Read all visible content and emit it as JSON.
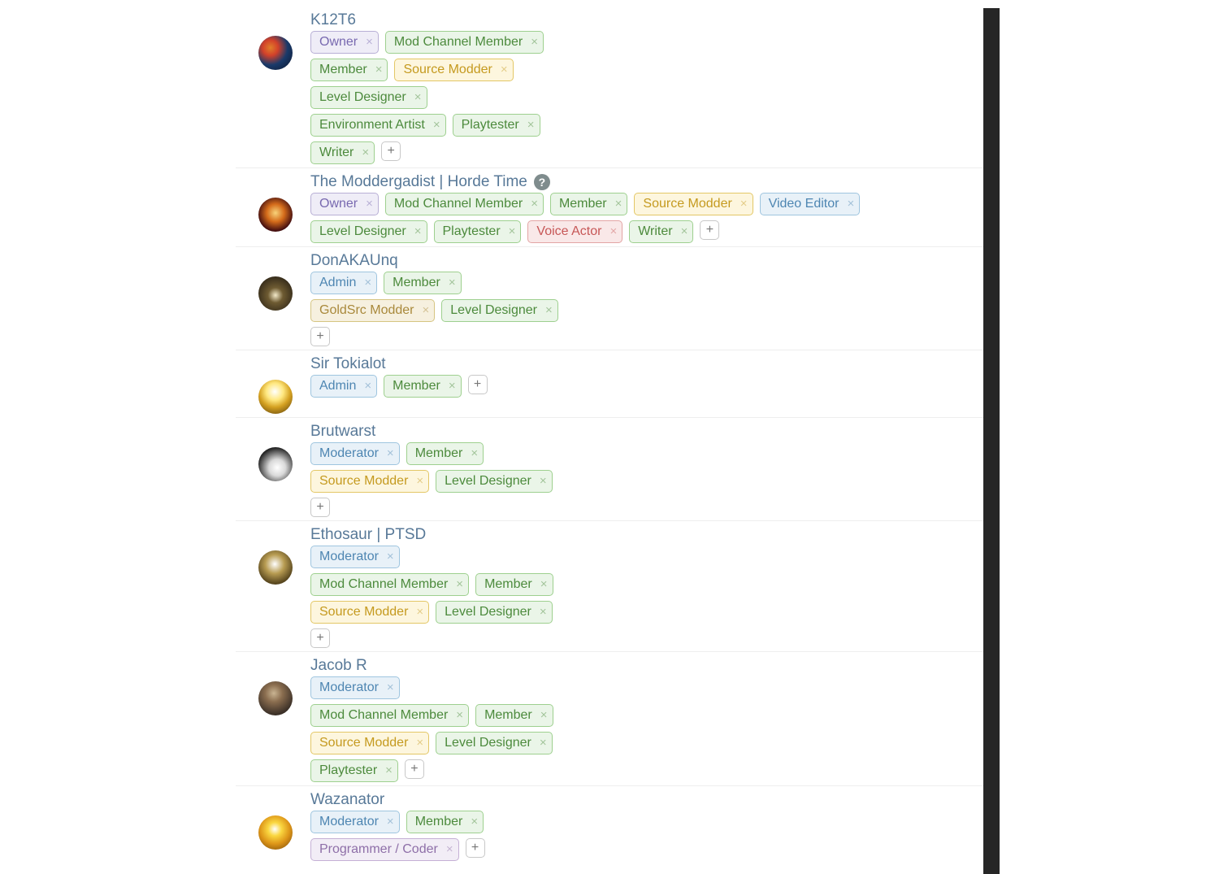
{
  "addLabel": "+",
  "removeLabel": "×",
  "members": [
    {
      "name": "K12T6",
      "avatarClass": "av-a",
      "tagRowMax": "315px",
      "hasQuestion": false,
      "tags": [
        {
          "label": "Owner",
          "color": "c-lav"
        },
        {
          "label": "Mod Channel Member",
          "color": "c-green"
        },
        {
          "label": "Member",
          "color": "c-green"
        },
        {
          "label": "Source Modder",
          "color": "c-yellow"
        },
        {
          "label": "Level Designer",
          "color": "c-green"
        },
        {
          "label": "Environment Artist",
          "color": "c-green"
        },
        {
          "label": "Playtester",
          "color": "c-green"
        },
        {
          "label": "Writer",
          "color": "c-green"
        }
      ]
    },
    {
      "name": "The Moddergadist | Horde Time",
      "avatarClass": "av-b",
      "tagRowMax": "720px",
      "hasQuestion": true,
      "tags": [
        {
          "label": "Owner",
          "color": "c-lav"
        },
        {
          "label": "Mod Channel Member",
          "color": "c-green"
        },
        {
          "label": "Member",
          "color": "c-green"
        },
        {
          "label": "Source Modder",
          "color": "c-yellow"
        },
        {
          "label": "Video Editor",
          "color": "c-blue"
        },
        {
          "label": "Level Designer",
          "color": "c-green"
        },
        {
          "label": "Playtester",
          "color": "c-green"
        },
        {
          "label": "Voice Actor",
          "color": "c-red"
        },
        {
          "label": "Writer",
          "color": "c-green"
        }
      ]
    },
    {
      "name": "DonAKAUnq",
      "avatarClass": "av-c",
      "tagRowMax": "305px",
      "hasQuestion": false,
      "tags": [
        {
          "label": "Admin",
          "color": "c-blue"
        },
        {
          "label": "Member",
          "color": "c-green"
        },
        {
          "label": "GoldSrc Modder",
          "color": "c-tan"
        },
        {
          "label": "Level Designer",
          "color": "c-green"
        }
      ]
    },
    {
      "name": "Sir Tokialot",
      "avatarClass": "av-d",
      "tagRowMax": "620px",
      "hasQuestion": false,
      "tags": [
        {
          "label": "Admin",
          "color": "c-blue"
        },
        {
          "label": "Member",
          "color": "c-green"
        }
      ]
    },
    {
      "name": "Brutwarst",
      "avatarClass": "av-e",
      "tagRowMax": "305px",
      "hasQuestion": false,
      "tags": [
        {
          "label": "Moderator",
          "color": "c-blue"
        },
        {
          "label": "Member",
          "color": "c-green"
        },
        {
          "label": "Source Modder",
          "color": "c-yellow"
        },
        {
          "label": "Level Designer",
          "color": "c-green"
        }
      ]
    },
    {
      "name": "Ethosaur | PTSD",
      "avatarClass": "av-f",
      "tagRowMax": "305px",
      "hasQuestion": false,
      "tags": [
        {
          "label": "Moderator",
          "color": "c-blue"
        },
        {
          "label": "Mod Channel Member",
          "color": "c-green"
        },
        {
          "label": "Member",
          "color": "c-green"
        },
        {
          "label": "Source Modder",
          "color": "c-yellow"
        },
        {
          "label": "Level Designer",
          "color": "c-green"
        }
      ]
    },
    {
      "name": "Jacob R",
      "avatarClass": "av-g",
      "tagRowMax": "305px",
      "hasQuestion": false,
      "tags": [
        {
          "label": "Moderator",
          "color": "c-blue"
        },
        {
          "label": "Mod Channel Member",
          "color": "c-green"
        },
        {
          "label": "Member",
          "color": "c-green"
        },
        {
          "label": "Source Modder",
          "color": "c-yellow"
        },
        {
          "label": "Level Designer",
          "color": "c-green"
        },
        {
          "label": "Playtester",
          "color": "c-green"
        }
      ]
    },
    {
      "name": "Wazanator",
      "avatarClass": "av-h",
      "tagRowMax": "305px",
      "hasQuestion": false,
      "tags": [
        {
          "label": "Moderator",
          "color": "c-blue"
        },
        {
          "label": "Member",
          "color": "c-green"
        },
        {
          "label": "Programmer / Coder",
          "color": "c-purple2"
        }
      ]
    }
  ]
}
